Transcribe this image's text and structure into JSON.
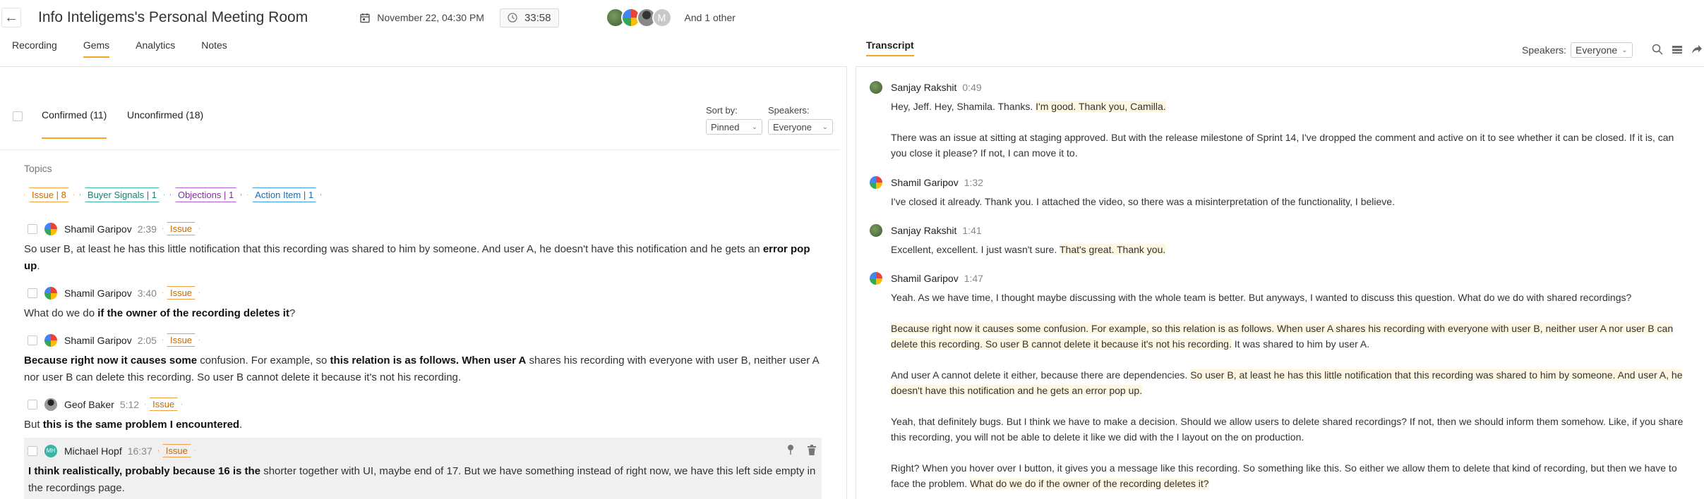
{
  "header": {
    "title": "Info Inteligems's Personal Meeting Room",
    "date": "November 22, 04:30 PM",
    "duration": "33:58",
    "participant_initial": "M",
    "others": "And 1 other"
  },
  "tabs": [
    "Recording",
    "Gems",
    "Analytics",
    "Notes"
  ],
  "active_tab": "Gems",
  "transcript_tab": "Transcript",
  "transcript_filter": {
    "label": "Speakers:",
    "value": "Everyone"
  },
  "gems": {
    "confirmed_label": "Confirmed (11)",
    "unconfirmed_label": "Unconfirmed (18)",
    "sort_label": "Sort by:",
    "sort_value": "Pinned",
    "speakers_label": "Speakers:",
    "speakers_value": "Everyone",
    "topics_label": "Topics",
    "topics": [
      {
        "label": "Issue | 8",
        "color": "#f0a145"
      },
      {
        "label": "Buyer Signals | 1",
        "color": "#3bb3a7"
      },
      {
        "label": "Objections | 1",
        "color": "#b65bd6"
      },
      {
        "label": "Action Item | 1",
        "color": "#3d9be9"
      }
    ],
    "items": [
      {
        "speaker": "Shamil Garipov",
        "time": "2:39",
        "tag": "Issue",
        "text_a": "So user B, at least he has this little notification that this recording was shared to him by someone. And user A, he doesn't have this notification and he gets an ",
        "bold_a": "error pop up",
        "text_b": "."
      },
      {
        "speaker": "Shamil Garipov",
        "time": "3:40",
        "tag": "Issue",
        "text_a": "What do we do ",
        "bold_a": "if the owner of the recording deletes it",
        "text_b": "?"
      },
      {
        "speaker": "Shamil Garipov",
        "time": "2:05",
        "tag": "Issue",
        "bold_a": "Because right now it causes some",
        "text_a": " confusion. For example, so ",
        "bold_b": "this relation is as follows. When user A",
        "text_b": " shares his recording with everyone with user B, neither user A nor user B can delete this recording. So user B cannot delete it because it's not his recording."
      },
      {
        "speaker": "Geof Baker",
        "time": "5:12",
        "tag": "Issue",
        "text_a": "But ",
        "bold_a": "this is the same problem I encountered",
        "text_b": "."
      },
      {
        "speaker": "Michael Hopf",
        "time": "16:37",
        "tag": "Issue",
        "initials": "MH",
        "bold_a": "I think realistically, probably because 16 is the",
        "text_a": " shorter together with UI, maybe end of 17. But we have something instead of right now, we have this left side empty in the recordings page."
      }
    ]
  },
  "transcript": [
    {
      "speaker": "Sanjay Rakshit",
      "time": "0:49",
      "p1_plain": "Hey, Jeff. Hey, Shamila. Thanks. ",
      "p1_hl": "I'm good. Thank you, Camilla.",
      "p2": "There was an issue at sitting at staging approved. But with the release milestone of Sprint 14, I've dropped the comment and active on it to see whether it can be closed. If it is, can you close it please? If not, I can move it to."
    },
    {
      "speaker": "Shamil Garipov",
      "time": "1:32",
      "p1": "I've closed it already. Thank you. I attached the video, so there was a misinterpretation of the functionality, I believe."
    },
    {
      "speaker": "Sanjay Rakshit",
      "time": "1:41",
      "p1_plain": "Excellent, excellent. I just wasn't sure. ",
      "p1_hl": "That's great. Thank you."
    },
    {
      "speaker": "Shamil Garipov",
      "time": "1:47",
      "p1": "Yeah. As we have time, I thought maybe discussing with the whole team is better. But anyways, I wanted to discuss this question. What do we do with shared recordings?",
      "p2_hl": "Because right now it causes some confusion. For example, so this relation is as follows. When user A shares his recording with everyone with user B, neither user A nor user B can delete this recording. So user B cannot delete it because it's not his recording.",
      "p2_plain": " It was shared to him by user A.",
      "p3_plain": "And user A cannot delete it either, because there are dependencies. ",
      "p3_hl": "So user B, at least he has this little notification that this recording was shared to him by someone. And user A, he doesn't have this notification and he gets an error pop up.",
      "p4": "Yeah, that definitely bugs. But I think we have to make a decision. Should we allow users to delete shared recordings? If not, then we should inform them somehow. Like, if you share this recording, you will not be able to delete it like we did with the I layout on the on production.",
      "p5_plain": "Right? When you hover over I button, it gives you a message like this recording. So something like this. So either we allow them to delete that kind of recording, but then we have to face the problem. ",
      "p5_hl": "What do we do if the owner of the recording deletes it?"
    }
  ]
}
